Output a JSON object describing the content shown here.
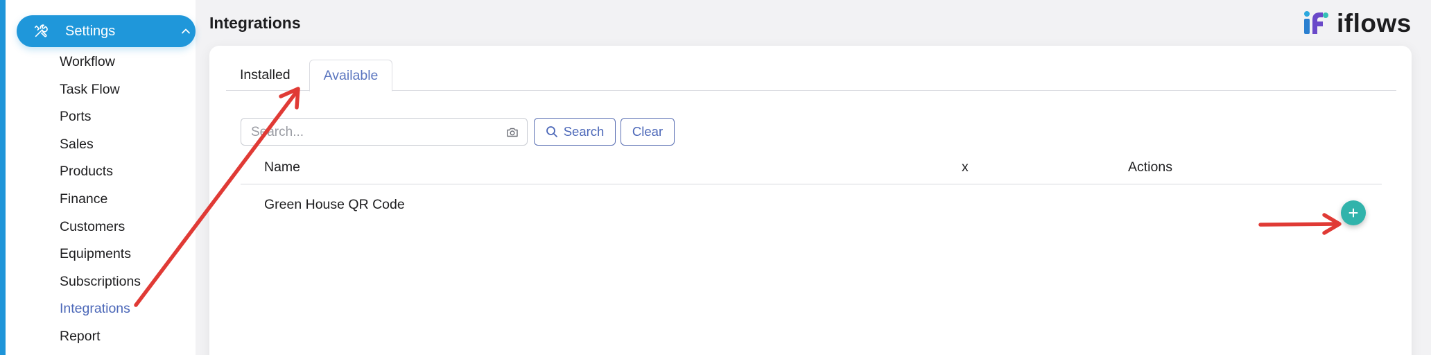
{
  "sidebar": {
    "settings_label": "Settings",
    "items": [
      {
        "label": "Workflow"
      },
      {
        "label": "Task Flow"
      },
      {
        "label": "Ports"
      },
      {
        "label": "Sales"
      },
      {
        "label": "Products"
      },
      {
        "label": "Finance"
      },
      {
        "label": "Customers"
      },
      {
        "label": "Equipments"
      },
      {
        "label": "Subscriptions"
      },
      {
        "label": "Integrations",
        "active": true
      },
      {
        "label": "Report"
      }
    ]
  },
  "header": {
    "title": "Integrations",
    "brand": "iflows"
  },
  "tabs": [
    {
      "label": "Installed"
    },
    {
      "label": "Available",
      "active": true
    }
  ],
  "search": {
    "placeholder": "Search...",
    "value": "",
    "search_label": "Search",
    "clear_label": "Clear"
  },
  "table": {
    "columns": [
      "Name",
      "x",
      "Actions"
    ],
    "rows": [
      {
        "name": "Green House QR Code"
      }
    ]
  },
  "colors": {
    "accent": "#1f97da",
    "active_link": "#4b67b8",
    "add_button": "#31b3ab",
    "annotation": "#e03a35"
  }
}
